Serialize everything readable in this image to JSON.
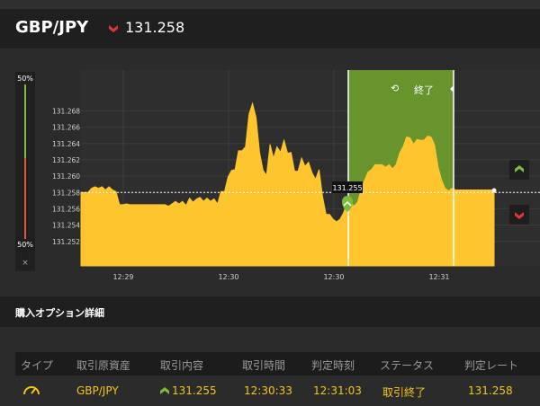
{
  "header": {
    "pair": "GBP/JPY",
    "rate": "131.258",
    "rate_direction": "down",
    "colors": {
      "down": "#e0343a",
      "up": "#7dbb3b",
      "accent": "#f5c518"
    }
  },
  "percent_bar": {
    "top": "50%",
    "bottom": "50%",
    "close": "×"
  },
  "side_buttons": {
    "high": "high-arrow-icon",
    "low": "low-arrow-icon"
  },
  "chart_data": {
    "type": "area",
    "x_ticks": [
      "12:29",
      "12:30",
      "12:30",
      "12:31"
    ],
    "y_ticks": [
      "131.252",
      "131.254",
      "131.256",
      "131.258",
      "131.260",
      "131.262",
      "131.264",
      "131.266",
      "131.268"
    ],
    "y_range": [
      131.249,
      131.273
    ],
    "entry_label": "131.255",
    "current_level": 131.258,
    "end_label": "終了",
    "grid": true,
    "values": [
      131.258,
      131.258,
      131.258,
      131.2585,
      131.2587,
      131.2585,
      131.2587,
      131.2583,
      131.2587,
      131.2583,
      131.2581,
      131.2565,
      131.2565,
      131.2566,
      131.2565,
      131.2565,
      131.2565,
      131.2565,
      131.2565,
      131.2565,
      131.2565,
      131.2565,
      131.2565,
      131.2565,
      131.2565,
      131.2563,
      131.2566,
      131.2569,
      131.2566,
      131.2569,
      131.2564,
      131.2573,
      131.2568,
      131.2572,
      131.2574,
      131.2569,
      131.2573,
      131.2569,
      131.2572,
      131.2566,
      131.2581,
      131.2581,
      131.2599,
      131.2607,
      131.2608,
      131.2631,
      131.2631,
      131.2636,
      131.2676,
      131.2689,
      131.2672,
      131.2629,
      131.2607,
      131.2601,
      131.2639,
      131.2622,
      131.2636,
      131.2629,
      131.2644,
      131.2628,
      131.2629,
      131.2606,
      131.2606,
      131.2622,
      131.2612,
      131.2617,
      131.2604,
      131.2596,
      131.2608,
      131.2575,
      131.2553,
      131.2553,
      131.2547,
      131.2544,
      131.2547,
      131.2555,
      131.2568,
      131.2568,
      131.2563,
      131.2568,
      131.2583,
      131.2595,
      131.2605,
      131.2608,
      131.2614,
      131.2614,
      131.2614,
      131.2611,
      131.2614,
      131.2609,
      131.2614,
      131.2628,
      131.2636,
      131.2648,
      131.2647,
      131.2639,
      131.2645,
      131.2644,
      131.2644,
      131.2649,
      131.2648,
      131.2638,
      131.2611,
      131.2595,
      131.2585,
      131.2582,
      131.2585,
      131.2583,
      131.2583,
      131.2583,
      131.2583,
      131.2583,
      131.2583,
      131.2583,
      131.2583,
      131.2583,
      131.2583,
      131.2583,
      131.2583
    ]
  },
  "details": {
    "title": "購入オプション詳細",
    "columns": [
      "タイプ",
      "取引原資産",
      "取引内容",
      "取引時間",
      "判定時刻",
      "ステータス",
      "判定レート"
    ],
    "row": {
      "type_icon": "gauge-icon",
      "asset": "GBP/JPY",
      "entry": "131.255",
      "trade_time": "12:30:33",
      "judge_time": "12:31:03",
      "status": "取引終了",
      "judge_rate": "131.258"
    }
  }
}
